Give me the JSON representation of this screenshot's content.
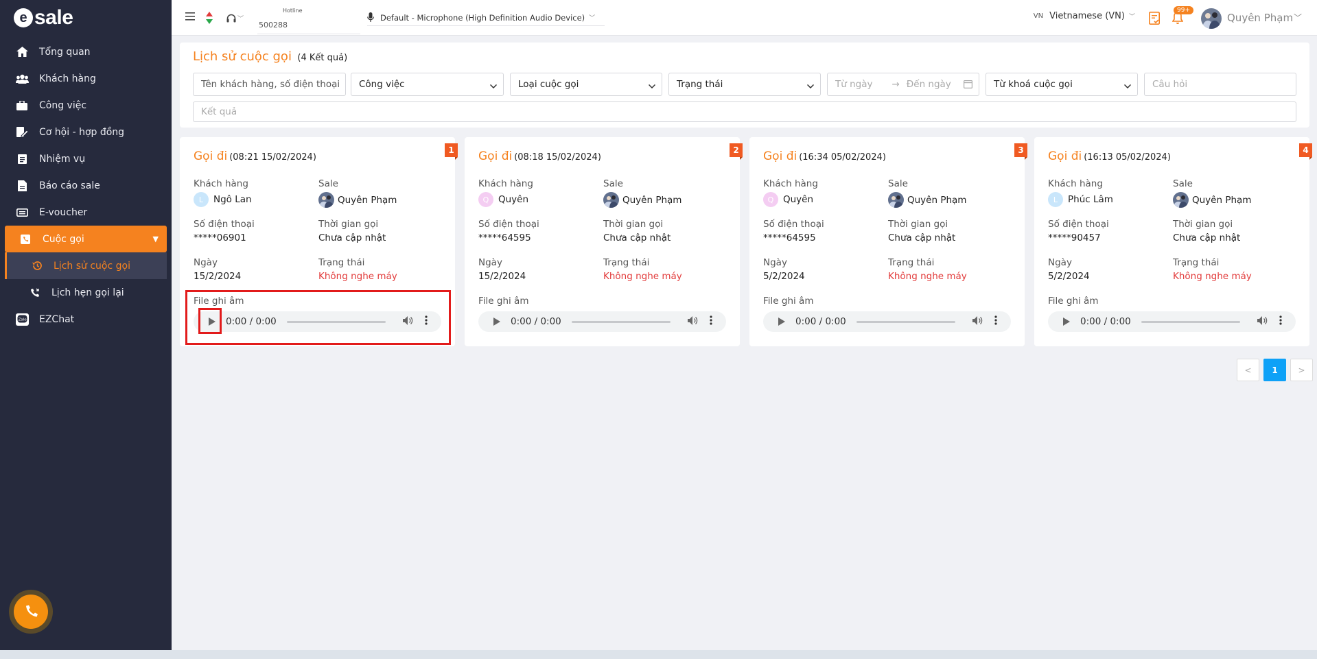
{
  "app": {
    "logo_letter": "e",
    "logo_text": "sale"
  },
  "sidebar": {
    "items": [
      {
        "label": "Tổng quan",
        "icon": "home-icon"
      },
      {
        "label": "Khách hàng",
        "icon": "users-icon"
      },
      {
        "label": "Công việc",
        "icon": "briefcase-icon"
      },
      {
        "label": "Cơ hội - hợp đồng",
        "icon": "contract-icon"
      },
      {
        "label": "Nhiệm vụ",
        "icon": "task-icon"
      },
      {
        "label": "Báo cáo sale",
        "icon": "report-icon"
      },
      {
        "label": "E-voucher",
        "icon": "voucher-icon"
      }
    ],
    "active_item": {
      "label": "Cuộc gọi",
      "icon": "phone-icon"
    },
    "sub_items": [
      {
        "label": "Lịch sử cuộc gọi",
        "icon": "history-icon"
      },
      {
        "label": "Lịch hẹn gọi lại",
        "icon": "callback-icon"
      }
    ],
    "ezchat": {
      "label": "EZChat",
      "icon": "zalo-icon"
    }
  },
  "topbar": {
    "hotline_label": "Hotline",
    "hotline_value": "500288",
    "microphone": "Default - Microphone (High Definition Audio Device)",
    "lang_code": "VN",
    "language": "Vietnamese (VN)",
    "notif_badge": "99+",
    "user_name": "Quyên Phạm"
  },
  "filters": {
    "title": "Lịch sử cuộc gọi",
    "count": "(4 Kết quả)",
    "customer_placeholder": "Tên khách hàng, số điện thoại",
    "job": "Công việc",
    "call_type": "Loại cuộc gọi",
    "status": "Trạng thái",
    "from_date": "Từ ngày",
    "to_date": "Đến ngày",
    "keyword": "Từ khoá cuộc gọi",
    "question": "Câu hỏi",
    "result": "Kết quả"
  },
  "labels": {
    "customer": "Khách hàng",
    "sale": "Sale",
    "phone": "Số điện thoại",
    "call_time": "Thời gian gọi",
    "date": "Ngày",
    "status": "Trạng thái",
    "recording": "File ghi âm",
    "player_time": "0:00 / 0:00"
  },
  "cards": [
    {
      "num": "1",
      "type": "Gọi đi",
      "time": "(08:21 15/02/2024)",
      "customer": "Ngô Lan",
      "initial": "L",
      "sale": "Quyên Phạm",
      "phone": "*****06901",
      "call_time": "Chưa cập nhật",
      "date": "15/2/2024",
      "status": "Không nghe máy"
    },
    {
      "num": "2",
      "type": "Gọi đi",
      "time": "(08:18 15/02/2024)",
      "customer": "Quyên",
      "initial": "Q",
      "sale": "Quyên Phạm",
      "phone": "*****64595",
      "call_time": "Chưa cập nhật",
      "date": "15/2/2024",
      "status": "Không nghe máy"
    },
    {
      "num": "3",
      "type": "Gọi đi",
      "time": "(16:34 05/02/2024)",
      "customer": "Quyên",
      "initial": "Q",
      "sale": "Quyên Phạm",
      "phone": "*****64595",
      "call_time": "Chưa cập nhật",
      "date": "5/2/2024",
      "status": "Không nghe máy"
    },
    {
      "num": "4",
      "type": "Gọi đi",
      "time": "(16:13 05/02/2024)",
      "customer": "Phúc Lâm",
      "initial": "L",
      "sale": "Quyên Phạm",
      "phone": "*****90457",
      "call_time": "Chưa cập nhật",
      "date": "5/2/2024",
      "status": "Không nghe máy"
    }
  ],
  "pagination": {
    "prev": "<",
    "page": "1",
    "next": ">"
  },
  "colors": {
    "accent": "#f5821f",
    "sidebar": "#262a3d",
    "status_red": "#e23b3b",
    "page_active": "#0ea1f7"
  }
}
